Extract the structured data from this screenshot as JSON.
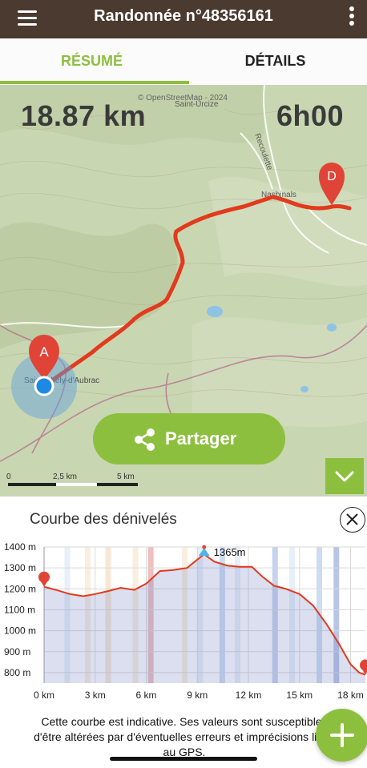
{
  "header": {
    "title": "Randonnée n°48356161",
    "menu_icon": "hamburger-menu-icon",
    "more_icon": "more-vertical-icon"
  },
  "tabs": [
    {
      "label": "RÉSUMÉ",
      "active": true
    },
    {
      "label": "DÉTAILS",
      "active": false
    }
  ],
  "map": {
    "distance": "18.87 km",
    "duration": "6h00",
    "attribution": "© OpenStreetMap - 2024",
    "place_labels": [
      "Saint-Urcize",
      "Recoulette",
      "Nasbinals",
      "Saint-Chély-d'Aubrac"
    ],
    "start_marker": "A",
    "end_marker": "D",
    "share_label": "Partager",
    "scale": {
      "zero": "0",
      "mid": "2,5 km",
      "max": "5 km"
    },
    "colors": {
      "route": "#e23a1c",
      "accent": "#8dbf3f",
      "marker": "#e04437",
      "location": "#1e88e5"
    }
  },
  "elevation": {
    "title": "Courbe des dénivelés",
    "peak_label": "1365m",
    "note": "Cette courbe est indicative. Ses valeurs sont susceptibles d'être altérées par d'éventuelles erreurs et imprécisions liées au GPS."
  },
  "chart_data": {
    "type": "area",
    "title": "Courbe des dénivelés",
    "x_unit": "km",
    "y_unit": "m",
    "xlim": [
      0,
      18.87
    ],
    "ylim": [
      750,
      1400
    ],
    "x_ticks": [
      "0 km",
      "3 km",
      "6 km",
      "9 km",
      "12 km",
      "15 km",
      "18 km"
    ],
    "y_ticks": [
      "1400 m",
      "1300 m",
      "1200 m",
      "1100 m",
      "1000 m",
      "900 m",
      "800 m"
    ],
    "grid": true,
    "series": [
      {
        "x": [
          0,
          0.7,
          1.5,
          2.3,
          3.0,
          3.8,
          4.5,
          5.3,
          6.0,
          6.8,
          7.6,
          8.4,
          9.0,
          9.4,
          10.0,
          10.8,
          11.5,
          12.2,
          12.8,
          13.5,
          14.2,
          15.0,
          15.8,
          16.6,
          17.3,
          18.0,
          18.5,
          18.87
        ],
        "y": [
          1210,
          1195,
          1175,
          1165,
          1175,
          1190,
          1205,
          1195,
          1225,
          1285,
          1290,
          1300,
          1340,
          1365,
          1330,
          1310,
          1305,
          1305,
          1260,
          1215,
          1200,
          1175,
          1120,
          1030,
          940,
          840,
          800,
          790
        ]
      }
    ],
    "annotations": [
      {
        "x": 9.4,
        "y": 1365,
        "text": "1365m"
      }
    ]
  },
  "fab": {
    "icon": "plus-icon"
  }
}
